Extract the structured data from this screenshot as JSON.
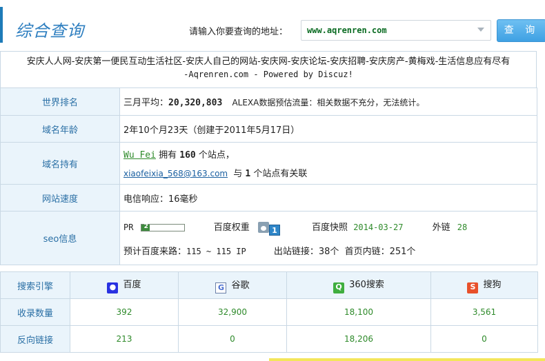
{
  "header": {
    "title": "综合查询",
    "query_label": "请输入你要查询的地址：",
    "query_value": "www.aqrenren.com",
    "query_button": "查 询"
  },
  "site": {
    "title_line1": "安庆人人网-安庆第一便民互动生活社区-安庆人自己的网站-安庆网-安庆论坛-安庆招聘-安庆房产-黄梅戏-生活信息应有尽有",
    "title_line2": "-Aqrenren.com - Powered by Discuz!"
  },
  "info": {
    "rank_label": "世界排名",
    "rank_prefix": "三月平均：",
    "rank_value": "20,320,803",
    "rank_suffix": "ALEXA数据预估流量：相关数据不充分，无法统计。",
    "age_label": "域名年龄",
    "age_value": "2年10个月23天（创建于2011年5月17日）",
    "owner_label": "域名持有",
    "owner_name": "Wu Fei",
    "owner_has": "拥有",
    "owner_sites": "160",
    "owner_sites_suffix": "个站点，",
    "owner_email": "xiaofeixia_568@163.com",
    "owner_email_with": "与",
    "owner_related": "1",
    "owner_related_suffix": "个站点有关联",
    "speed_label": "网站速度",
    "speed_value": "电信响应：16毫秒",
    "seo_label": "seo信息",
    "pr_label": "PR",
    "pr_value": "2",
    "pr_fraction": 0.2,
    "baidu_weight_label": "百度权重",
    "baidu_weight_value": "1",
    "baidu_snapshot_label": "百度快照",
    "baidu_snapshot_value": "2014-03-27",
    "outlinks_label": "外链",
    "outlinks_value": "28",
    "traffic_label": "预计百度来路：",
    "traffic_value": "115 ~ 115 IP",
    "out_links_label": "出站链接：",
    "out_links_value": "38个",
    "home_links_label": "首页内链：",
    "home_links_value": "251个"
  },
  "engines": {
    "header_label": "搜索引擎",
    "indexed_label": "收录数量",
    "backlinks_label": "反向链接",
    "baidu": {
      "name": "百度",
      "indexed": "392",
      "backlinks": "213"
    },
    "google": {
      "name": "谷歌",
      "indexed": "32,900",
      "backlinks": "0"
    },
    "s360": {
      "name": "360搜索",
      "indexed": "18,100",
      "backlinks": "18,206"
    },
    "sogou": {
      "name": "搜狗",
      "indexed": "3,561",
      "backlinks": "0"
    }
  },
  "colors": {
    "accent": "#2f7fc0",
    "label_bg": "#eaf4fb",
    "border": "#c9d8e4",
    "value_green": "#2e8a2a"
  }
}
